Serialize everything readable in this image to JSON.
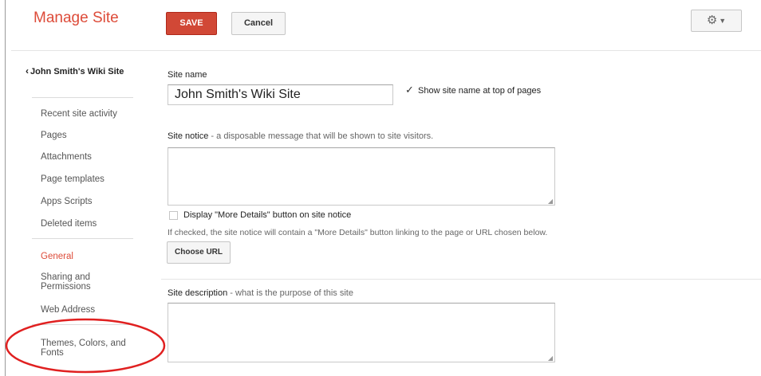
{
  "header": {
    "title": "Manage Site",
    "save_label": "SAVE",
    "cancel_label": "Cancel",
    "settings_icon": "gear-icon"
  },
  "sidebar": {
    "site_title": "John Smith's Wiki Site",
    "items": [
      {
        "label": "Recent site activity"
      },
      {
        "label": "Pages"
      },
      {
        "label": "Attachments"
      },
      {
        "label": "Page templates"
      },
      {
        "label": "Apps Scripts"
      },
      {
        "label": "Deleted items"
      },
      {
        "label": "General",
        "active": true
      },
      {
        "label": "Sharing and Permissions"
      },
      {
        "label": "Web Address"
      },
      {
        "label": "Themes, Colors, and Fonts"
      }
    ]
  },
  "form": {
    "site_name_label": "Site name",
    "site_name_value": "John Smith's Wiki Site",
    "show_site_name_label": "Show site name at top of pages",
    "show_site_name_checked": true,
    "site_notice_label": "Site notice",
    "site_notice_hint": " - a disposable message that will be shown to site visitors.",
    "site_notice_value": "",
    "more_details_label": "Display \"More Details\" button on site notice",
    "more_details_checked": false,
    "more_details_help": "If checked, the site notice will contain a \"More Details\" button linking to the page or URL chosen below.",
    "choose_url_label": "Choose URL",
    "site_description_label": "Site description",
    "site_description_hint": " - what is the purpose of this site",
    "site_description_value": ""
  },
  "colors": {
    "accent": "#dd4b39",
    "save_button": "#d14836",
    "annotation_circle": "#e02020"
  }
}
